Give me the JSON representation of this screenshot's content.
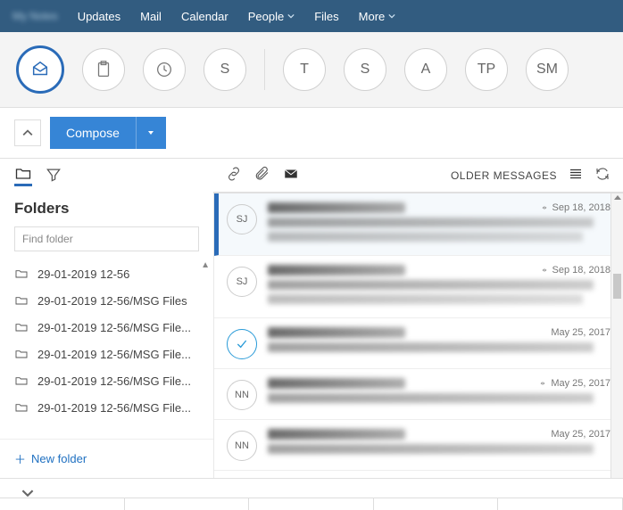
{
  "topnav": {
    "brand": "My Notes",
    "items": [
      "Updates",
      "Mail",
      "Calendar",
      "People",
      "Files",
      "More"
    ]
  },
  "circles": {
    "avatars": [
      "S",
      "T",
      "S",
      "A",
      "TP",
      "SM"
    ]
  },
  "compose": {
    "label": "Compose"
  },
  "folders": {
    "header": "Folders",
    "find_placeholder": "Find folder",
    "items": [
      "29-01-2019 12-56",
      "29-01-2019 12-56/MSG Files",
      "29-01-2019 12-56/MSG File...",
      "29-01-2019 12-56/MSG File...",
      "29-01-2019 12-56/MSG File...",
      "29-01-2019 12-56/MSG File..."
    ],
    "new_label": "New folder"
  },
  "msghead": {
    "older": "OLDER MESSAGES"
  },
  "messages": [
    {
      "avatar": "SJ",
      "date": "Sep 18, 2018",
      "selected": true,
      "check": false
    },
    {
      "avatar": "SJ",
      "date": "Sep 18, 2018",
      "selected": false,
      "check": false
    },
    {
      "avatar": "",
      "date": "May 25, 2017",
      "selected": false,
      "check": true
    },
    {
      "avatar": "NN",
      "date": "May 25, 2017",
      "selected": false,
      "check": false
    },
    {
      "avatar": "NN",
      "date": "May 25, 2017",
      "selected": false,
      "check": false
    }
  ]
}
